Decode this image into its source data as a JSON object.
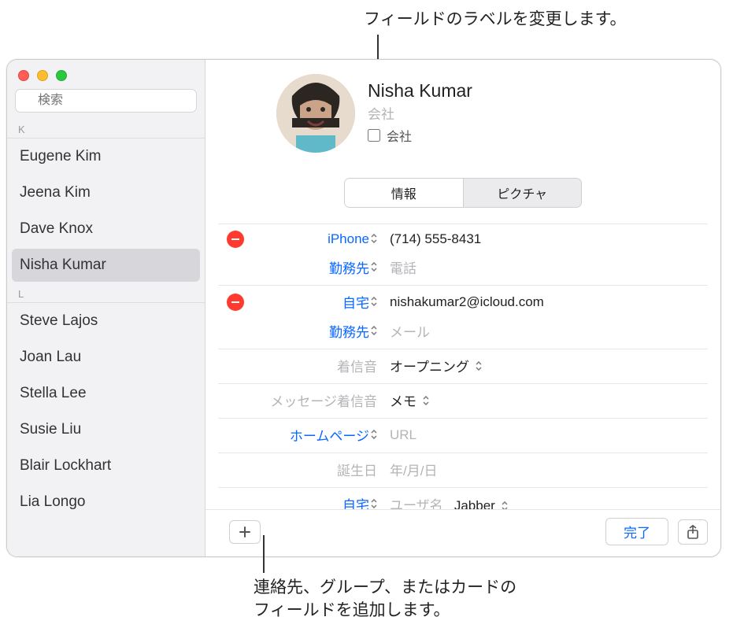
{
  "callouts": {
    "top": "フィールドのラベルを変更します。",
    "bottom_line1": "連絡先、グループ、またはカードの",
    "bottom_line2": "フィールドを追加します。"
  },
  "sidebar": {
    "search_placeholder": "検索",
    "sections": [
      {
        "letter": "K",
        "items": [
          "Eugene Kim",
          "Jeena Kim",
          "Dave Knox",
          "Nisha Kumar"
        ]
      },
      {
        "letter": "L",
        "items": [
          "Steve Lajos",
          "Joan Lau",
          "Stella Lee",
          "Susie Liu",
          "Blair Lockhart",
          "Lia Longo"
        ]
      }
    ],
    "selected": "Nisha Kumar"
  },
  "card": {
    "name": "Nisha  Kumar",
    "company_placeholder": "会社",
    "company_checkbox_label": "会社",
    "tabs": {
      "info": "情報",
      "picture": "ピクチャ"
    },
    "fields": {
      "phone_label": "iPhone",
      "phone_value": "(714) 555-8431",
      "phone2_label": "勤務先",
      "phone2_placeholder": "電話",
      "email_label": "自宅",
      "email_value": "nishakumar2@icloud.com",
      "email2_label": "勤務先",
      "email2_placeholder": "メール",
      "ringtone_label": "着信音",
      "ringtone_value": "オープニング",
      "texttone_label": "メッセージ着信音",
      "texttone_value": "メモ",
      "homepage_label": "ホームページ",
      "homepage_placeholder": "URL",
      "birthday_label": "誕生日",
      "birthday_placeholder": "年/月/日",
      "im_label": "自宅",
      "im_placeholder": "ユーザ名",
      "im_service": "Jabber"
    },
    "footer": {
      "done": "完了"
    }
  }
}
